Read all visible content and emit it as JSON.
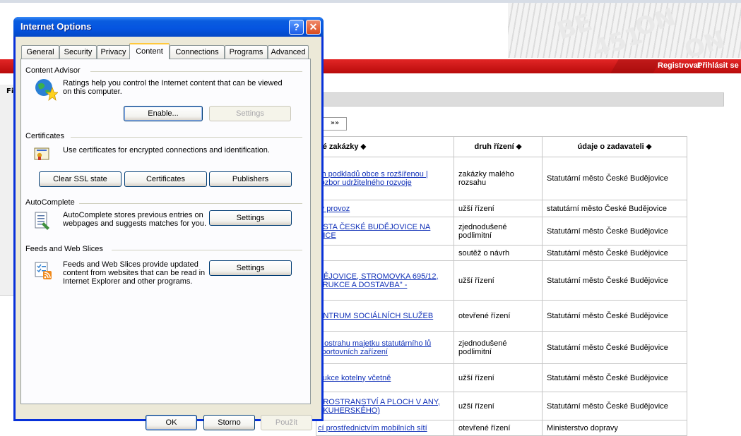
{
  "background_page": {
    "nav": {
      "register": "Registrovat",
      "login": "Přihlásit se"
    },
    "left_label": "Fi",
    "pager_next": "»»",
    "table": {
      "headers": [
        "né zakázky ⬥",
        "druh řízení ⬥",
        "údaje o zadavateli ⬥"
      ],
      "rows": [
        {
          "c1": "ch podkladů obce s rozšířenou | rozbor udržitelného rozvoje",
          "c2": "zakázky malého rozsahu",
          "c3": "Statutární město České Budějovice"
        },
        {
          "c1": "rý provoz",
          "c2": "užší řízení",
          "c3": "statutární město České Budějovice"
        },
        {
          "c1": "ĚSTA ČESKÉ BUDĚJOVICE NA VICE",
          "c2": "zjednodušené podlimitní",
          "c3": "Statutární město České Budějovice"
        },
        {
          "c1": "",
          "c2": "soutěž o návrh",
          "c3": "Statutární město České Budějovice"
        },
        {
          "c1": "DĚJOVICE, STROMOVKA 695/12, TRUKCE A DOSTAVBA\" -",
          "c2": "užší řízení",
          "c3": "Statutární město České Budějovice"
        },
        {
          "c1": "ENTRUM SOCIÁLNÍCH SLUŽEB",
          "c2": "otevřené řízení",
          "c3": "Statutární město České Budějovice"
        },
        {
          "c1": "a ostrahu majetku statutárního lů sportovních zařízení",
          "c2": "zjednodušené podlimitní",
          "c3": "Statutární město České Budějovice"
        },
        {
          "c1": "trukce kotelny včetně",
          "c2": "užší řízení",
          "c3": "Statutární město České Budějovice"
        },
        {
          "c1": "PROSTRANSTVÍ A PLOCH V ANY, SKUHERSKÉHO)",
          "c2": "užší řízení",
          "c3": "Statutární město České Budějovice"
        },
        {
          "c1": "cí prostřednictvím mobilních sítí",
          "c2": "otevřené řízení",
          "c3": "Ministerstvo dopravy"
        }
      ]
    }
  },
  "dialog": {
    "title": "Internet Options",
    "help_label": "?",
    "close_label": "✕",
    "tabs": [
      "General",
      "Security",
      "Privacy",
      "Content",
      "Connections",
      "Programs",
      "Advanced"
    ],
    "selected_tab": "Content",
    "content_advisor": {
      "heading": "Content Advisor",
      "text": "Ratings help you control the Internet content that can be viewed on this computer.",
      "enable": "Enable...",
      "settings": "Settings"
    },
    "certificates": {
      "heading": "Certificates",
      "text": "Use certificates for encrypted connections and identification.",
      "clear_ssl": "Clear SSL state",
      "certificates": "Certificates",
      "publishers": "Publishers"
    },
    "autocomplete": {
      "heading": "AutoComplete",
      "text": "AutoComplete stores previous entries on webpages and suggests matches for you.",
      "settings": "Settings"
    },
    "feeds": {
      "heading": "Feeds and Web Slices",
      "text": "Feeds and Web Slices provide updated content from websites that can be read in Internet Explorer and other programs.",
      "settings": "Settings"
    },
    "footer": {
      "ok": "OK",
      "cancel": "Storno",
      "apply": "Použít"
    }
  }
}
